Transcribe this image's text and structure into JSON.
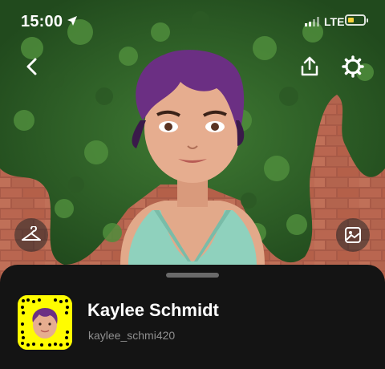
{
  "status_bar": {
    "time": "15:00",
    "network": "LTE",
    "battery_color": "#f6d23b"
  },
  "toolbar": {
    "back_icon": "chevron-left-icon",
    "share_icon": "share-icon",
    "settings_icon": "gear-icon"
  },
  "side_buttons": {
    "outfit_icon": "hanger-icon",
    "backdrop_icon": "photo-icon"
  },
  "profile": {
    "display_name": "Kaylee Schmidt",
    "username": "kaylee_schmi420"
  },
  "colors": {
    "sheet": "#141414",
    "snapcode": "#fffc00",
    "hair": "#6b2f83"
  }
}
